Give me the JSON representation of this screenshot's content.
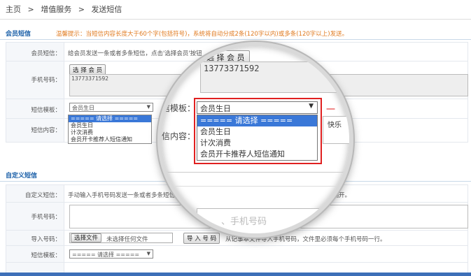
{
  "breadcrumb": {
    "home": "主页",
    "sep1": ">",
    "service": "增值服务",
    "sep2": ">",
    "current": "发送短信"
  },
  "member_section": {
    "title": "会员短信",
    "tip": "温馨提示：当短信内容长度大于60个字(包括符号)，系统将自动分成2条(120字以内)或多条(120字以上)发送。",
    "rows": {
      "sms_label": "会员短信：",
      "sms_desc": "给会员发送一条或者多条短信，点击'选择会员'按钮",
      "phone_label": "手机号码：",
      "select_member": "选 择 会 员",
      "phone_value": "13773371592",
      "template_label": "短信模板：",
      "template_selected": "会员生日",
      "template_options": [
        "===== 请选择 =====",
        "会员生日",
        "计次消费",
        "会员开卡推荐人短信通知"
      ],
      "content_label": "短信内容："
    }
  },
  "custom_section": {
    "title": "自定义短信",
    "rows": {
      "sms_label": "自定义短信：",
      "sms_desc": "手动输入手机号码发送一条或者多条短信",
      "sms_desc_tail": "号隔开。",
      "phone_label": "手机号码：",
      "import_label": "导入号码：",
      "choose_file": "选择文件",
      "no_file": "未选择任何文件",
      "import_btn": "导 入 号 码",
      "import_desc": "从记事本文件导入手机号码，文件里必须每个手机号码一行。",
      "template_label": "短信模板：",
      "template_selected": "===== 请选择 ====="
    }
  },
  "magnifier": {
    "select_member": "选 择 会 员",
    "phone_value": "13773371592",
    "template_label": "信模板：",
    "template_selected": "会员生日",
    "template_options": [
      "===== 请选择 =====",
      "会员生日",
      "计次消费",
      "会员开卡推荐人短信通知"
    ],
    "content_label": "信内容：",
    "right_text": "快乐",
    "partial_text": "、手机号码",
    "red_mark": "一"
  },
  "colors": {
    "accent": "#1a5fa8",
    "tip": "#e07a1f",
    "highlight": "#e02020",
    "selection": "#3a78d8"
  }
}
